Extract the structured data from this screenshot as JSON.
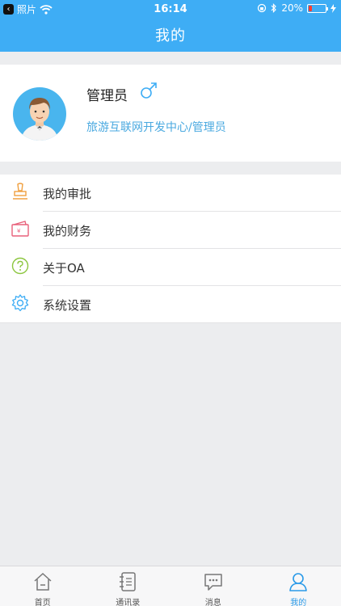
{
  "status_bar": {
    "back_app": "照片",
    "time": "16:14",
    "battery_percent": "20%",
    "battery_level": 0.2
  },
  "header": {
    "title": "我的"
  },
  "profile": {
    "name": "管理员",
    "organization": "旅游互联网开发中心/管理员",
    "gender_icon": "male-symbol-icon"
  },
  "menu": {
    "items": [
      {
        "label": "我的审批",
        "icon": "stamp-icon",
        "color": "#f0a040"
      },
      {
        "label": "我的财务",
        "icon": "wallet-icon",
        "color": "#e8607a"
      },
      {
        "label": "关于OA",
        "icon": "question-circle-icon",
        "color": "#8cc63f"
      },
      {
        "label": "系统设置",
        "icon": "gear-icon",
        "color": "#3eadf5"
      }
    ]
  },
  "tabbar": {
    "tabs": [
      {
        "label": "首页",
        "icon": "home-icon"
      },
      {
        "label": "通讯录",
        "icon": "contacts-book-icon"
      },
      {
        "label": "消息",
        "icon": "message-bubble-icon"
      },
      {
        "label": "我的",
        "icon": "person-icon",
        "active": true
      }
    ]
  },
  "colors": {
    "primary": "#3eadf5",
    "background": "#ecedef",
    "active_tab": "#2a9ae8"
  }
}
